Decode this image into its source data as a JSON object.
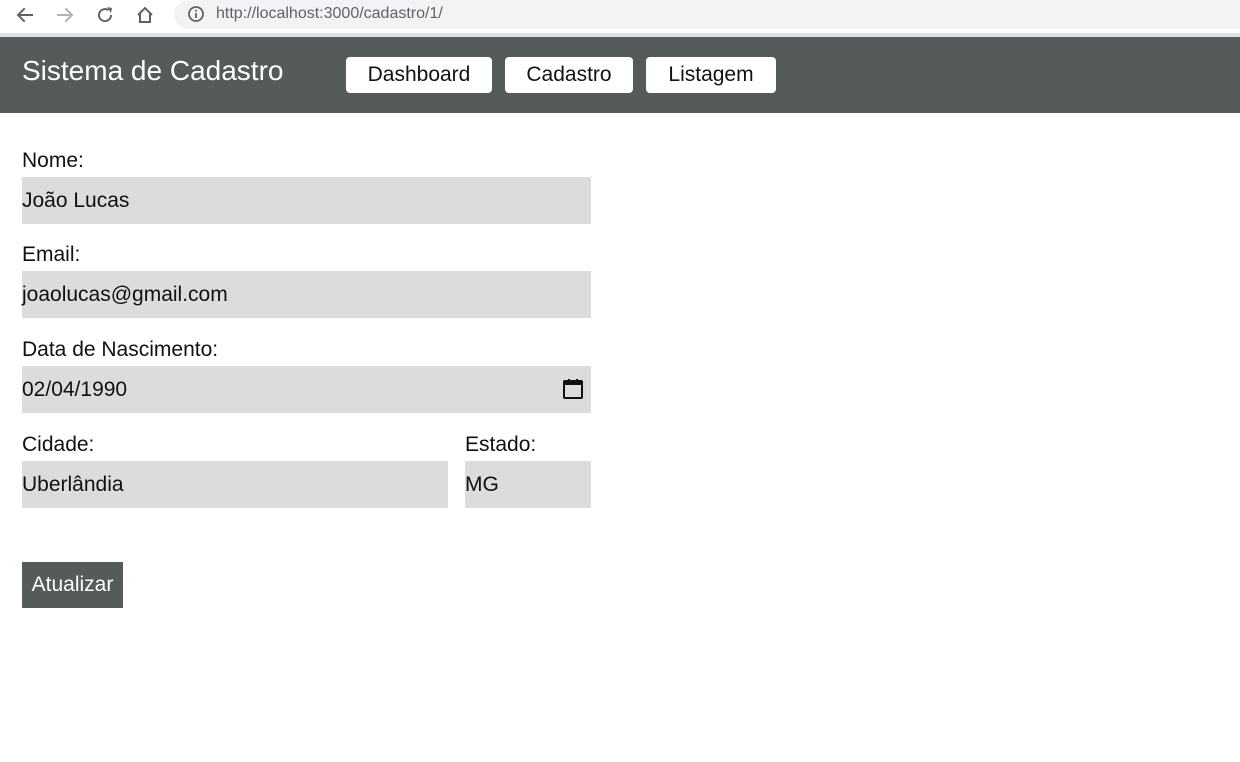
{
  "browser": {
    "url": "http://localhost:3000/cadastro/1/",
    "icons": [
      "back-arrow-icon",
      "forward-arrow-icon",
      "reload-icon",
      "home-icon",
      "info-icon"
    ]
  },
  "header": {
    "title": "Sistema de Cadastro",
    "nav": {
      "dashboard": "Dashboard",
      "cadastro": "Cadastro",
      "listagem": "Listagem"
    }
  },
  "form": {
    "nome": {
      "label": "Nome:",
      "value": "João Lucas"
    },
    "email": {
      "label": "Email:",
      "value": "joaolucas@gmail.com"
    },
    "nascimento": {
      "label": "Data de Nascimento:",
      "value": "02/04/1990"
    },
    "cidade": {
      "label": "Cidade:",
      "value": "Uberlândia"
    },
    "estado": {
      "label": "Estado:",
      "value": "MG"
    },
    "submit_label": "Atualizar"
  },
  "colors": {
    "header_bg": "#555a5a",
    "input_bg": "#dcdcdc",
    "button_bg": "#555a5a"
  }
}
